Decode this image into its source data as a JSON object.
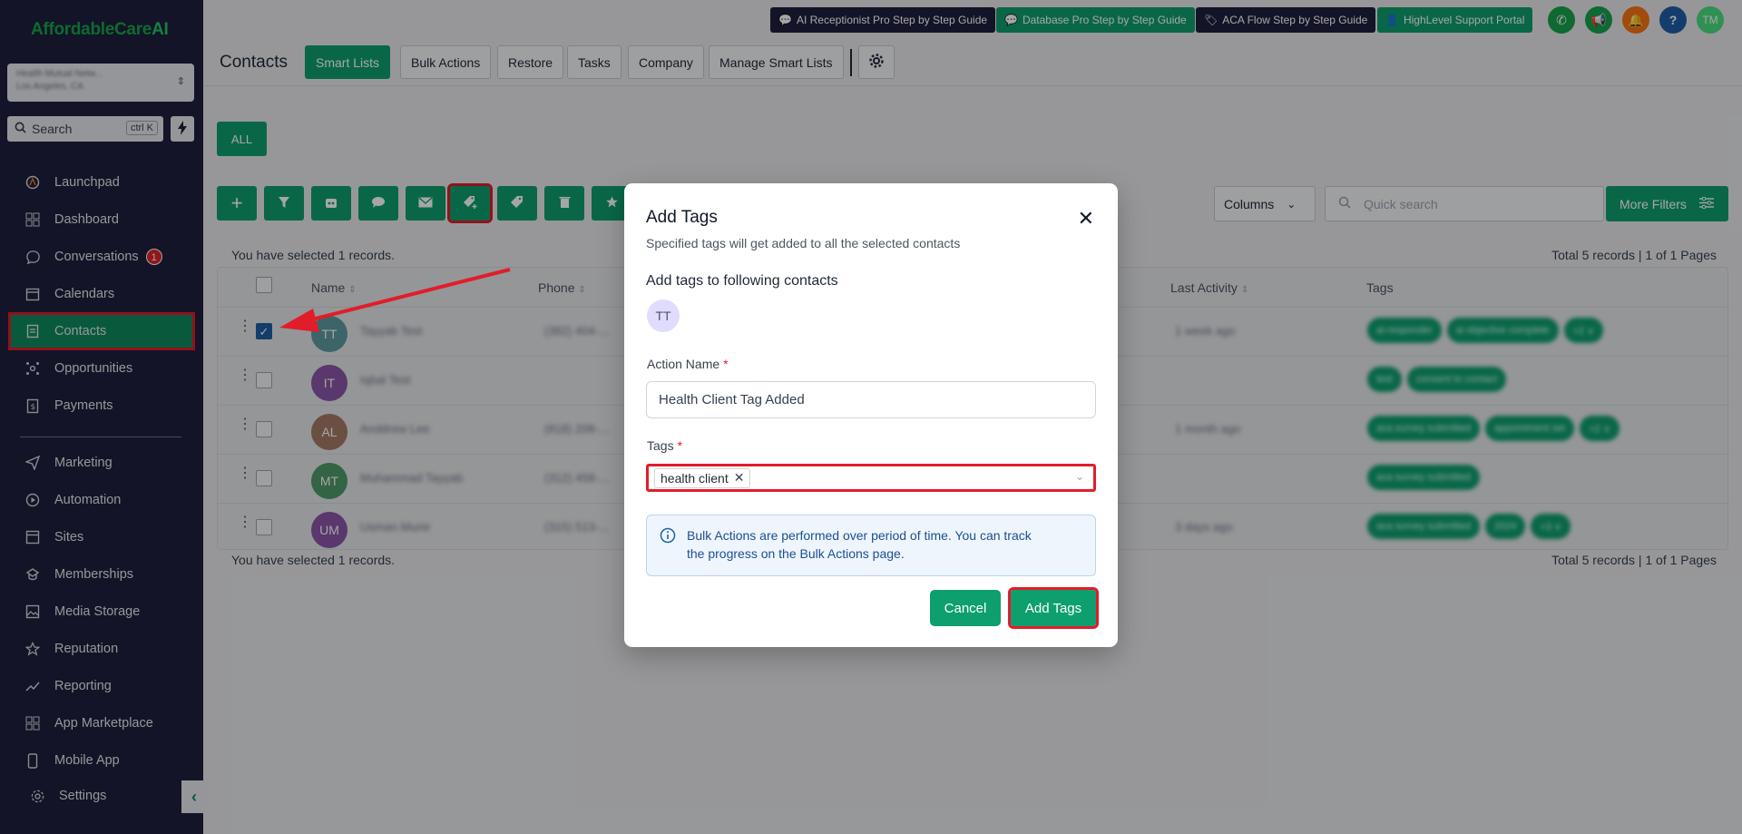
{
  "sidebar": {
    "logo": {
      "text": "AffordableCare",
      "accent": "AI"
    },
    "location": {
      "line1": "Health Mutual Netw...",
      "line2": "Los Angeles, CA"
    },
    "search": {
      "label": "Search",
      "shortcut": "ctrl K"
    },
    "items": [
      {
        "label": "Launchpad",
        "icon": "rocket-icon"
      },
      {
        "label": "Dashboard",
        "icon": "grid-icon"
      },
      {
        "label": "Conversations",
        "icon": "chat-icon",
        "badge": "1"
      },
      {
        "label": "Calendars",
        "icon": "calendar-icon"
      },
      {
        "label": "Contacts",
        "icon": "contacts-icon",
        "active": true
      },
      {
        "label": "Opportunities",
        "icon": "opportunities-icon"
      },
      {
        "label": "Payments",
        "icon": "payments-icon"
      },
      {
        "label": "Marketing",
        "icon": "send-icon"
      },
      {
        "label": "Automation",
        "icon": "automation-icon"
      },
      {
        "label": "Sites",
        "icon": "sites-icon"
      },
      {
        "label": "Memberships",
        "icon": "memberships-icon"
      },
      {
        "label": "Media Storage",
        "icon": "image-icon"
      },
      {
        "label": "Reputation",
        "icon": "star-icon"
      },
      {
        "label": "Reporting",
        "icon": "chart-icon"
      },
      {
        "label": "App Marketplace",
        "icon": "apps-icon"
      },
      {
        "label": "Mobile App",
        "icon": "mobile-icon"
      },
      {
        "label": "Settings",
        "icon": "gear-icon"
      }
    ]
  },
  "topbar": {
    "guides": [
      {
        "label": "AI Receptionist Pro Step by Step Guide",
        "color": "#1e1f3d"
      },
      {
        "label": "Database Pro Step by Step Guide",
        "color": "#0e9f6e"
      },
      {
        "label": "ACA Flow Step by Step Guide",
        "color": "#1e1f3d"
      },
      {
        "label": "HighLevel Support Portal",
        "color": "#0e9f6e"
      }
    ],
    "user_initials": "TM"
  },
  "contacts": {
    "title": "Contacts",
    "tabs": [
      "Smart Lists",
      "Bulk Actions",
      "Restore",
      "Tasks",
      "Company",
      "Manage Smart Lists"
    ],
    "all_label": "ALL",
    "columns_label": "Columns",
    "quick_search_placeholder": "Quick search",
    "more_filters_label": "More Filters",
    "selected_text": "You have selected 1 records.",
    "total_text": "Total 5 records | 1 of 1 Pages",
    "headers": {
      "name": "Name",
      "phone": "Phone",
      "last_activity": "Last Activity",
      "tags": "Tags"
    },
    "rows": [
      {
        "initials": "TT",
        "name": "Tayyab Test",
        "phone": "(382) 404-...",
        "activity": "1 week ago",
        "color": "#5f9aa0",
        "checked": true,
        "tags": [
          "ai-responder",
          "ai objective complete",
          "+2 ∨"
        ]
      },
      {
        "initials": "IT",
        "name": "Iqbal Test",
        "phone": "",
        "activity": "",
        "color": "#8a55a6",
        "checked": false,
        "tags": [
          "test",
          "consent to contact"
        ]
      },
      {
        "initials": "AL",
        "name": "Anddrew Lee",
        "phone": "(818) 208-...",
        "activity": "1 month ago",
        "color": "#a57a68",
        "checked": false,
        "tags": [
          "aca survey submitted",
          "appointment set",
          "+2 ∨"
        ]
      },
      {
        "initials": "MT",
        "name": "Muhammad Tayyab",
        "phone": "(312) 458-...",
        "activity": "",
        "color": "#4e9a6b",
        "checked": false,
        "tags": [
          "aca survey submitted"
        ]
      },
      {
        "initials": "UM",
        "name": "Usman Munir",
        "phone": "(315) 513-...",
        "activity": "3 days ago",
        "color": "#8a55a6",
        "checked": false,
        "tags": [
          "aca survey submitted",
          "2024",
          "+3 ∨"
        ]
      }
    ]
  },
  "modal": {
    "title": "Add Tags",
    "subtitle": "Specified tags will get added to all the selected contacts",
    "section_label": "Add tags to following contacts",
    "contact_initials": "TT",
    "action_name_label": "Action Name",
    "action_name_value": "Health Client Tag Added",
    "tags_label": "Tags",
    "tag_values": [
      "health client"
    ],
    "info_text": "Bulk Actions are performed over period of time. You can track the progress on the Bulk Actions page.",
    "cancel_label": "Cancel",
    "submit_label": "Add Tags"
  }
}
